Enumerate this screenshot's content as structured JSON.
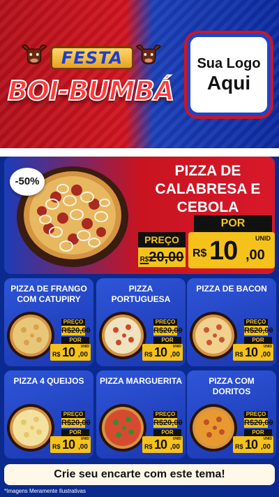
{
  "header": {
    "festa": "FESTA",
    "boi_bumba": "BOI-BUMBÁ",
    "logo_line1": "Sua Logo",
    "logo_line2": "Aqui"
  },
  "featured": {
    "discount": "-50%",
    "title": "PIZZA DE CALABRESA E CEBOLA",
    "preco_label": "PREÇO",
    "old_price": "20,00",
    "old_currency": "R$",
    "por_label": "POR",
    "currency": "R$",
    "new_price_int": "10",
    "new_price_cents": ",00",
    "unit": "UNID"
  },
  "cards": [
    {
      "title": "PIZZA DE FRANGO COM CATUPIRY",
      "preco_label": "PREÇO",
      "old_price": "R$20,00",
      "por_label": "POR",
      "currency": "R$",
      "price_int": "10",
      "price_cents": ",00",
      "unit": "UNID",
      "topping": "#e8c77a",
      "accent": "#d9a24a"
    },
    {
      "title": "PIZZA PORTUGUESA",
      "preco_label": "PREÇO",
      "old_price": "R$20,00",
      "por_label": "POR",
      "currency": "R$",
      "price_int": "10",
      "price_cents": ",00",
      "unit": "UNID",
      "topping": "#f0e2c0",
      "accent": "#c84a2a"
    },
    {
      "title": "PIZZA DE BACON",
      "preco_label": "PREÇO",
      "old_price": "R$20,00",
      "por_label": "POR",
      "currency": "R$",
      "price_int": "10",
      "price_cents": ",00",
      "unit": "UNID",
      "topping": "#f2d08e",
      "accent": "#c9573a"
    },
    {
      "title": "PIZZA 4 QUEIJOS",
      "preco_label": "PREÇO",
      "old_price": "R$20,00",
      "por_label": "POR",
      "currency": "R$",
      "price_int": "10",
      "price_cents": ",00",
      "unit": "UNID",
      "topping": "#f4e1a0",
      "accent": "#e5c86a"
    },
    {
      "title": "PIZZA MARGUERITA",
      "preco_label": "PREÇO",
      "old_price": "R$20,00",
      "por_label": "POR",
      "currency": "R$",
      "price_int": "10",
      "price_cents": ",00",
      "unit": "UNID",
      "topping": "#d84a30",
      "accent": "#3b8a34"
    },
    {
      "title": "PIZZA COM DORITOS",
      "preco_label": "PREÇO",
      "old_price": "R$20,00",
      "por_label": "POR",
      "currency": "R$",
      "price_int": "10",
      "price_cents": ",00",
      "unit": "UNID",
      "topping": "#e89a30",
      "accent": "#c0502a"
    }
  ],
  "cta": "Crie seu encarte com este tema!",
  "disclaimer": "*Imagens Meramente Ilustrativas",
  "colors": {
    "red": "#d01420",
    "blue": "#1a3fb8",
    "yellow": "#f5c21b"
  }
}
